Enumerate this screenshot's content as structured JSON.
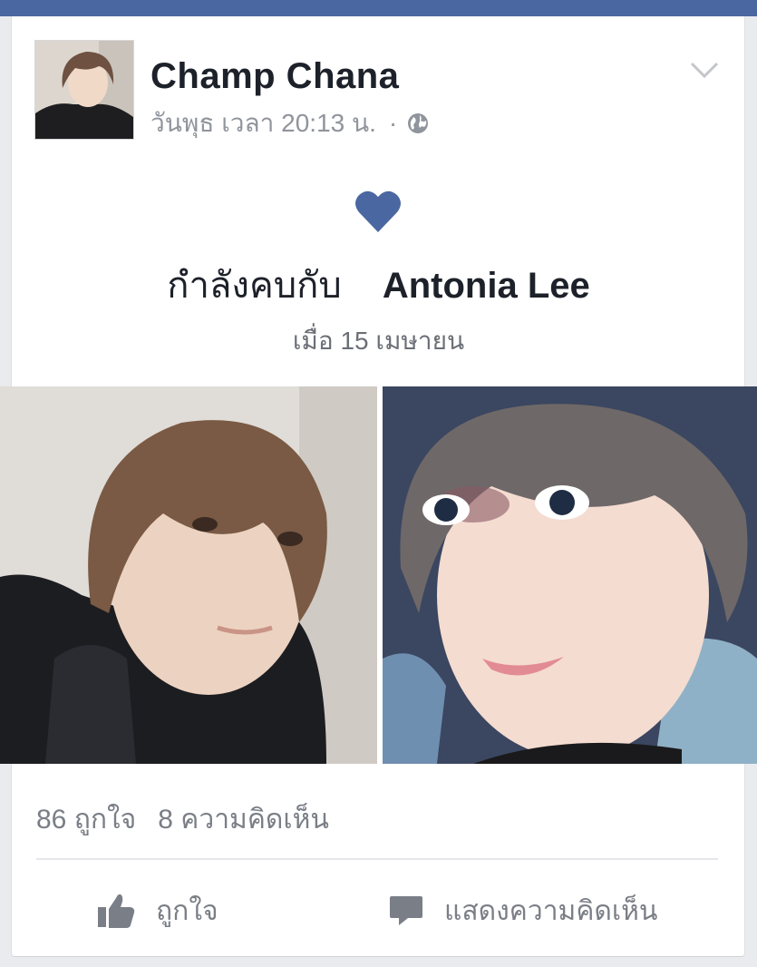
{
  "post": {
    "author": "Champ Chana",
    "meta": {
      "timestamp": "วันพุธ เวลา 20:13 น.",
      "separator": "·",
      "privacy_icon": "globe-icon"
    },
    "menu_icon": "chevron-down-icon",
    "life_event": {
      "icon": "heart-icon",
      "relationship_text": "กำลังคบกับ",
      "partner": "Antonia Lee",
      "since": "เมื่อ 15 เมษายน"
    }
  },
  "engagement": {
    "likes": "86 ถูกใจ",
    "comments": "8 ความคิดเห็น"
  },
  "actions": {
    "like_label": "ถูกใจ",
    "like_icon": "thumbs-up-icon",
    "comment_label": "แสดงความคิดเห็น",
    "comment_icon": "comment-bubble-icon"
  },
  "colors": {
    "top_bar": "#4b67a1",
    "heart": "#4b67a1",
    "text_primary": "#1d2129",
    "text_secondary": "#90949c"
  }
}
